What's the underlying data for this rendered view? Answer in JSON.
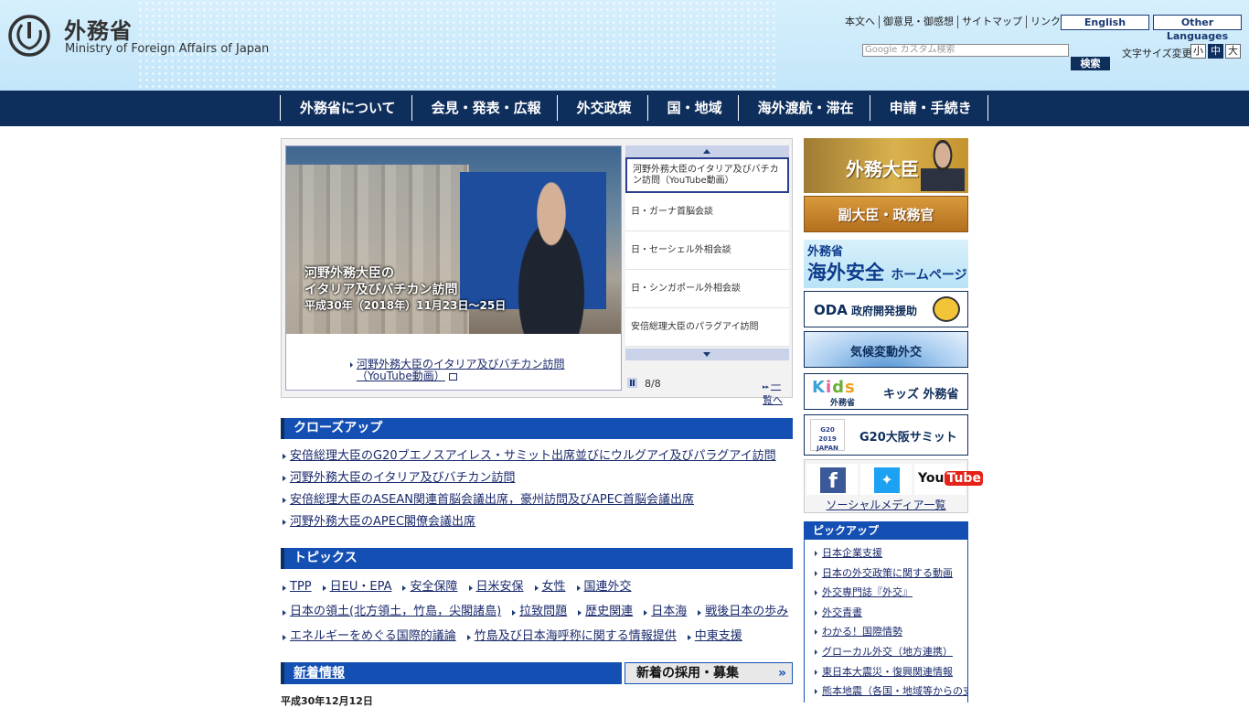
{
  "header": {
    "logo_jp": "外務省",
    "logo_en": "Ministry of Foreign Affairs of Japan",
    "util_links": [
      "本文へ",
      "御意見・御感想",
      "サイトマップ",
      "リンク集"
    ],
    "lang_english": "English",
    "lang_other": "Other Languages",
    "search_placeholder": "Google カスタム検索",
    "search_button": "検索",
    "fontsize_label": "文字サイズ変更",
    "fontsize_options": [
      "小",
      "中",
      "大"
    ],
    "fontsize_selected": "中"
  },
  "nav": [
    "外務省について",
    "会見・発表・広報",
    "外交政策",
    "国・地域",
    "海外渡航・滞在",
    "申請・手続き"
  ],
  "carousel": {
    "caption_line1": "河野外務大臣の",
    "caption_line2": "イタリア及びバチカン訪問",
    "caption_line3": "平成30年（2018年）11月23日〜25日",
    "link_line1": "河野外務大臣のイタリア及びバチカン訪問",
    "link_line2": "（YouTube動画）",
    "thumbs": [
      "河野外務大臣のイタリア及びバチカン訪問（YouTube動画）",
      "日・ガーナ首脳会談",
      "日・セーシェル外相会談",
      "日・シンガポール外相会談",
      "安倍総理大臣のパラグアイ訪問"
    ],
    "counter": "8/8",
    "list_link": "一覧へ"
  },
  "closeup": {
    "title": "クローズアップ",
    "items": [
      "安倍総理大臣のG20ブエノスアイレス・サミット出席並びにウルグアイ及びパラグアイ訪問",
      "河野外務大臣のイタリア及びバチカン訪問",
      "安倍総理大臣のASEAN関連首脳会議出席，豪州訪問及びAPEC首脳会議出席",
      "河野外務大臣のAPEC閣僚会議出席"
    ]
  },
  "topics": {
    "title": "トピックス",
    "row1": [
      "TPP",
      "日EU・EPA",
      "安全保障",
      "日米安保",
      "女性",
      "国連外交"
    ],
    "row2": [
      "日本の領土(北方領土，竹島，尖閣諸島)",
      "拉致問題",
      "歴史関連",
      "日本海",
      "戦後日本の歩み"
    ],
    "row3": [
      "エネルギーをめぐる国際的議論",
      "竹島及び日本海呼称に関する情報提供",
      "中東支援"
    ]
  },
  "news": {
    "tab_new": "新着情報",
    "tab_recruit": "新着の採用・募集",
    "date": "平成30年12月12日"
  },
  "banners": {
    "minister": "外務大臣",
    "vice": "副大臣・政務官",
    "safety_top": "外務省",
    "safety_main": "海外安全",
    "safety_sub": "ホームページ",
    "oda": "ODA",
    "oda_sub": "政府開発援助",
    "climate": "気候変動外交",
    "kids_letters": [
      "K",
      "i",
      "d",
      "s"
    ],
    "kids_sub": "外務省",
    "kids": "キッズ 外務省",
    "g20_logo": "G20 2019 JAPAN",
    "g20": "G20大阪サミット"
  },
  "social": {
    "facebook": "f",
    "twitter": "t",
    "youtube_a": "You",
    "youtube_b": "Tube",
    "link": "ソーシャルメディア一覧"
  },
  "pickup": {
    "title": "ピックアップ",
    "items": [
      "日本企業支援",
      "日本の外交政策に関する動画",
      "外交専門誌『外交』",
      "外交青書",
      "わかる！国際情勢",
      "グローカル外交（地方連携）",
      "東日本大震災・復興関連情報",
      "熊本地震（各国・地域等からの支援等）"
    ]
  },
  "colors": {
    "nav_bg": "#0e2e5c",
    "section_blue": "#1450b4",
    "header_sky": "#c3e6fa"
  }
}
